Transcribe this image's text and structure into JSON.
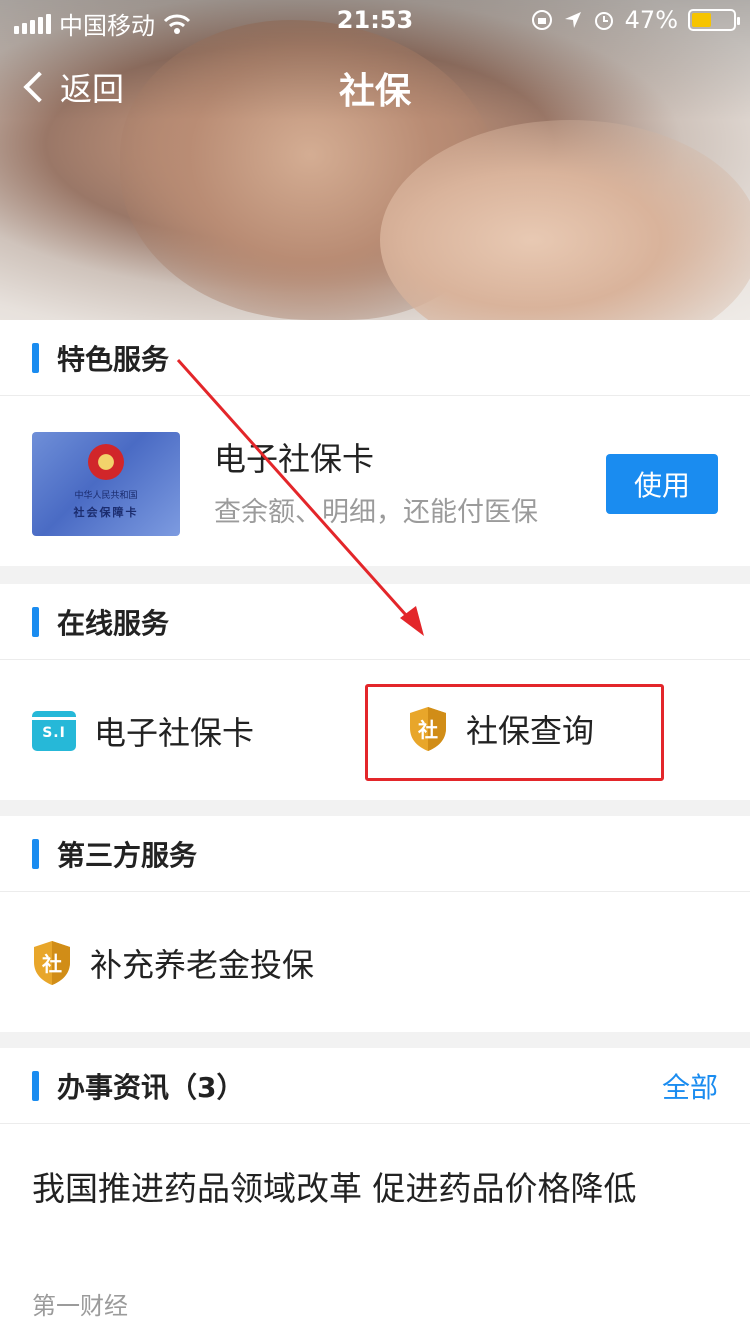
{
  "status_bar": {
    "carrier": "中国移动",
    "time": "21:53",
    "battery": "47%",
    "battery_level": 0.47
  },
  "nav": {
    "back_label": "返回",
    "title": "社保"
  },
  "featured": {
    "heading": "特色服务",
    "card": {
      "line1": "中华人民共和国",
      "line2": "社会保障卡"
    },
    "item_title": "电子社保卡",
    "item_subtitle": "查余额、明细，还能付医保",
    "button_label": "使用"
  },
  "online": {
    "heading": "在线服务",
    "items": [
      {
        "label": "电子社保卡",
        "icon": "si-card-icon",
        "icon_text": "S.I"
      },
      {
        "label": "社保查询",
        "icon": "shield-icon",
        "icon_text": "社"
      }
    ]
  },
  "third_party": {
    "heading": "第三方服务",
    "items": [
      {
        "label": "补充养老金投保",
        "icon": "shield-icon",
        "icon_text": "社"
      }
    ]
  },
  "news": {
    "heading": "办事资讯（3）",
    "more_label": "全部",
    "items": [
      {
        "title": "我国推进药品领域改革 促进药品价格降低",
        "source": "第一财经"
      }
    ]
  },
  "colors": {
    "accent": "#1a8cf0",
    "annotation": "#e3262a",
    "shield": "#e8a62a"
  }
}
